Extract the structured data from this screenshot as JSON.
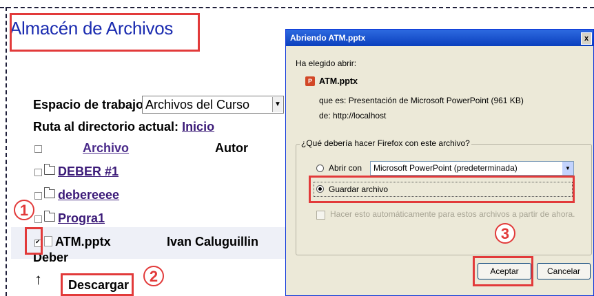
{
  "page": {
    "title": "Almacén de Archivos",
    "workspace_label": "Espacio de trabajo",
    "workspace_value": "Archivos del Curso",
    "path_label": "Ruta al directorio actual:",
    "path_link": "Inicio",
    "columns": {
      "archivo": "Archivo",
      "autor": "Autor"
    },
    "folders": [
      "DEBER #1",
      "debereeee",
      "Progra1"
    ],
    "file": {
      "name": "ATM.pptx",
      "author": "Ivan Caluguillin",
      "extra": "Deber"
    },
    "download_label": "Descargar",
    "up_icon_glyph": "↑"
  },
  "callouts": [
    "1",
    "2",
    "3"
  ],
  "dialog": {
    "title": "Abriendo ATM.pptx",
    "close_glyph": "x",
    "intro": "Ha elegido abrir:",
    "file_name": "ATM.pptx",
    "type_line": "que es: Presentación de Microsoft PowerPoint (961 KB)",
    "from_line": "de: http://localhost",
    "question": "¿Qué debería hacer Firefox con este archivo?",
    "open_with_label": "Abrir con",
    "open_with_app": "Microsoft PowerPoint (predeterminada)",
    "save_label": "Guardar archivo",
    "auto_label": "Hacer esto automáticamente para estos archivos a partir de ahora.",
    "accept_label": "Aceptar",
    "cancel_label": "Cancelar",
    "ppt_icon_text": "P"
  },
  "colors": {
    "accent": "#e23a3a",
    "title": "#1a2bb0",
    "link": "#3b1a78",
    "dialog_bg": "#ece9d8",
    "titlebar": "#0b3fbd"
  }
}
